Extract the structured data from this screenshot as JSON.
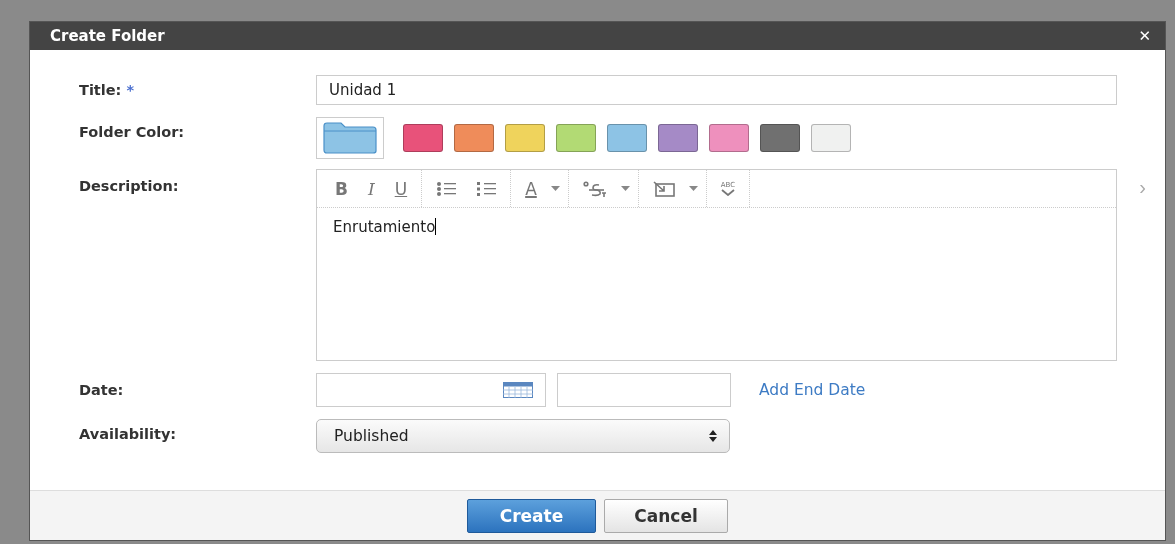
{
  "dialog": {
    "title": "Create Folder",
    "close": "✕"
  },
  "fields": {
    "title": {
      "label": "Title:",
      "required": "*",
      "value": "Unidad 1"
    },
    "folder_color": {
      "label": "Folder Color:",
      "preview": {
        "color": "#8dc3e5"
      },
      "swatches": [
        {
          "color": "#e8527a"
        },
        {
          "color": "#ef8c5a"
        },
        {
          "color": "#efd35c"
        },
        {
          "color": "#b2da74"
        },
        {
          "color": "#8dc3e5"
        },
        {
          "color": "#a58ac6"
        },
        {
          "color": "#ee90bd"
        },
        {
          "color": "#707070"
        },
        {
          "color": "#f0f1f0"
        }
      ]
    },
    "description": {
      "label": "Description:",
      "toolbar": [
        {
          "kind": "bold",
          "text": "B"
        },
        {
          "kind": "italic",
          "text": "I"
        },
        {
          "kind": "underline",
          "text": "U"
        },
        {
          "kind": "sep"
        },
        {
          "kind": "bullets"
        },
        {
          "kind": "numbers"
        },
        {
          "kind": "sep"
        },
        {
          "kind": "fontcolor",
          "text": "A"
        },
        {
          "kind": "caret"
        },
        {
          "kind": "sep"
        },
        {
          "kind": "script"
        },
        {
          "kind": "caret"
        },
        {
          "kind": "sep"
        },
        {
          "kind": "insert"
        },
        {
          "kind": "caret"
        },
        {
          "kind": "sep"
        },
        {
          "kind": "spell",
          "text": "ABC"
        },
        {
          "kind": "sep"
        }
      ],
      "more": "›",
      "value": "Enrutamiento"
    },
    "date": {
      "label": "Date:",
      "link": "Add End Date"
    },
    "availability": {
      "label": "Availability:",
      "value": "Published"
    }
  },
  "buttons": [
    {
      "label": "Create",
      "kind": "primary"
    },
    {
      "label": "Cancel",
      "kind": "secondary"
    }
  ]
}
